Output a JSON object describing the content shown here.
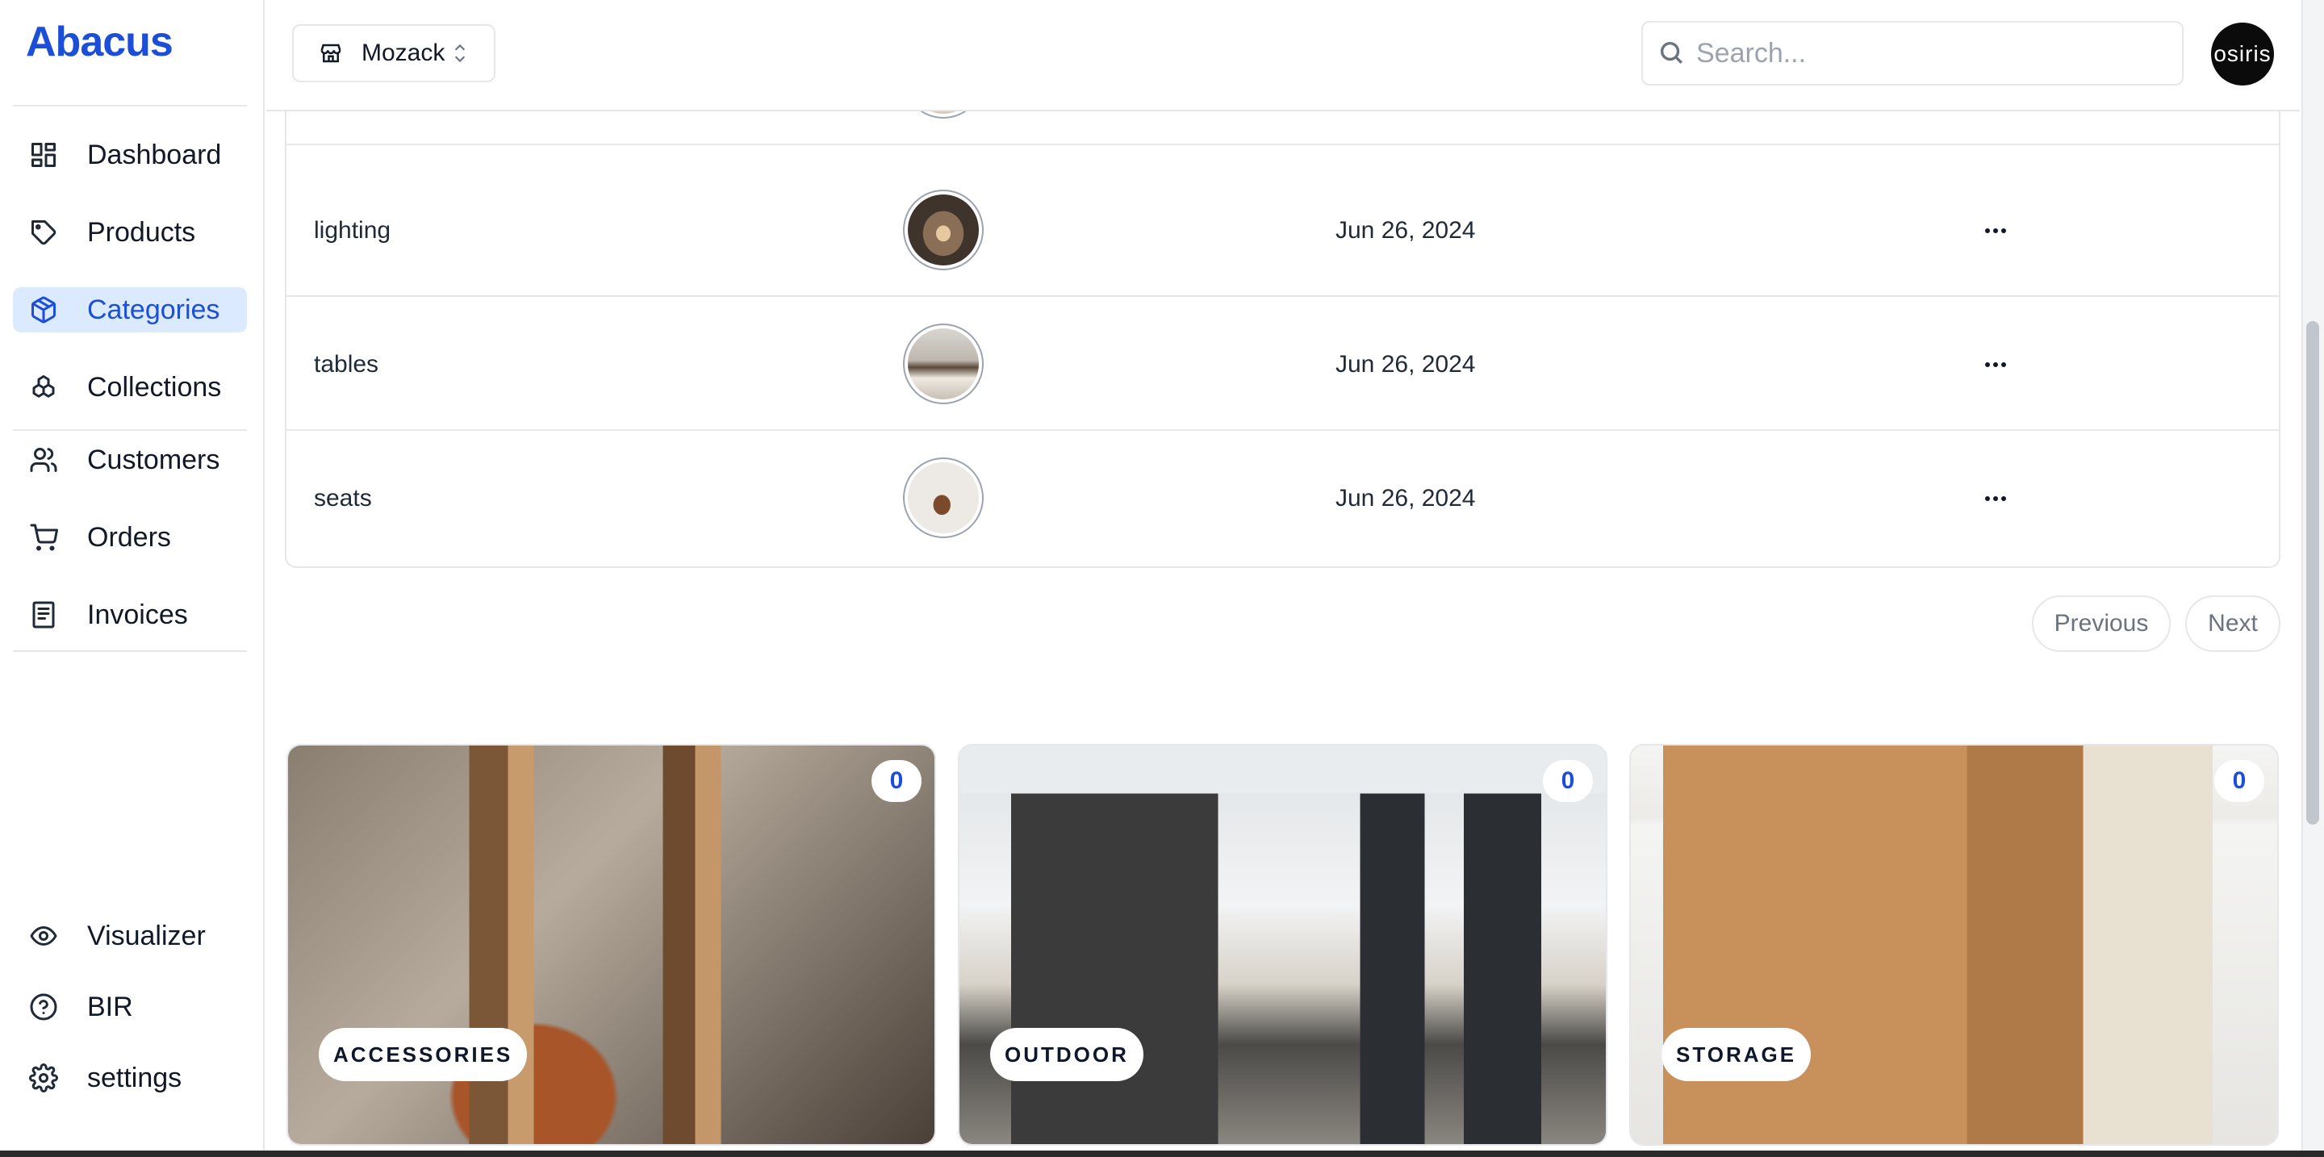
{
  "app": {
    "logo": "Abacus"
  },
  "sidebar": {
    "items": [
      {
        "label": "Dashboard",
        "icon": "dashboard-icon"
      },
      {
        "label": "Products",
        "icon": "tag-icon"
      },
      {
        "label": "Categories",
        "icon": "box-icon",
        "active": true
      },
      {
        "label": "Collections",
        "icon": "collections-icon"
      },
      {
        "label": "Customers",
        "icon": "users-icon"
      },
      {
        "label": "Orders",
        "icon": "cart-icon"
      },
      {
        "label": "Invoices",
        "icon": "receipt-icon"
      }
    ],
    "bottom_items": [
      {
        "label": "Visualizer",
        "icon": "eye-icon"
      },
      {
        "label": "BIR",
        "icon": "help-circle-icon"
      },
      {
        "label": "settings",
        "icon": "gear-icon"
      }
    ]
  },
  "header": {
    "store_name": "Mozack",
    "search_placeholder": "Search...",
    "avatar_text": "osiris"
  },
  "table": {
    "rows": [
      {
        "name": "lighting",
        "date": "Jun 26, 2024"
      },
      {
        "name": "tables",
        "date": "Jun 26, 2024"
      },
      {
        "name": "seats",
        "date": "Jun 26, 2024"
      }
    ]
  },
  "pagination": {
    "previous": "Previous",
    "next": "Next"
  },
  "cards": [
    {
      "label": "ACCESSORIES",
      "count": "0"
    },
    {
      "label": "OUTDOOR",
      "count": "0"
    },
    {
      "label": "STORAGE",
      "count": "0"
    }
  ],
  "colors": {
    "accent": "#1d4ed8",
    "active_bg": "#dbeafe",
    "border": "#e5e7eb"
  }
}
